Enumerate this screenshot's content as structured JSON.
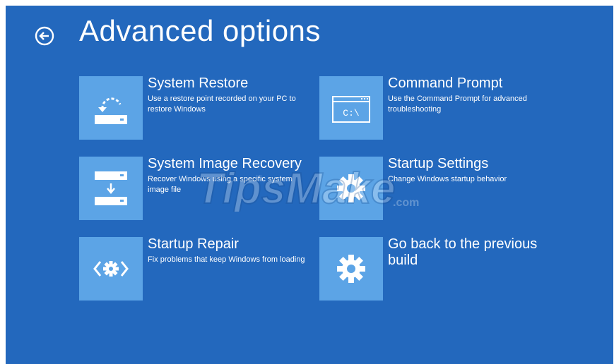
{
  "header": {
    "title": "Advanced options",
    "back_icon": "back-arrow-circle-icon"
  },
  "options": [
    {
      "title": "System Restore",
      "description": "Use a restore point recorded on your PC to restore Windows",
      "icon": "system-restore-icon"
    },
    {
      "title": "Command Prompt",
      "description": "Use the Command Prompt for advanced troubleshooting",
      "icon": "command-prompt-icon",
      "icon_text": "C:\\"
    },
    {
      "title": "System Image Recovery",
      "description": "Recover Windows using a specific system image file",
      "icon": "system-image-recovery-icon"
    },
    {
      "title": "Startup Settings",
      "description": "Change Windows startup behavior",
      "icon": "gear-icon"
    },
    {
      "title": "Startup Repair",
      "description": "Fix problems that keep Windows from loading",
      "icon": "startup-repair-icon"
    },
    {
      "title": "Go back to the previous build",
      "description": "",
      "icon": "gear-icon"
    }
  ],
  "watermark": {
    "text": "TipsMake",
    "suffix": ".com"
  },
  "colors": {
    "background": "#2368bd",
    "tile": "#5ca4e6",
    "text": "#ffffff"
  }
}
